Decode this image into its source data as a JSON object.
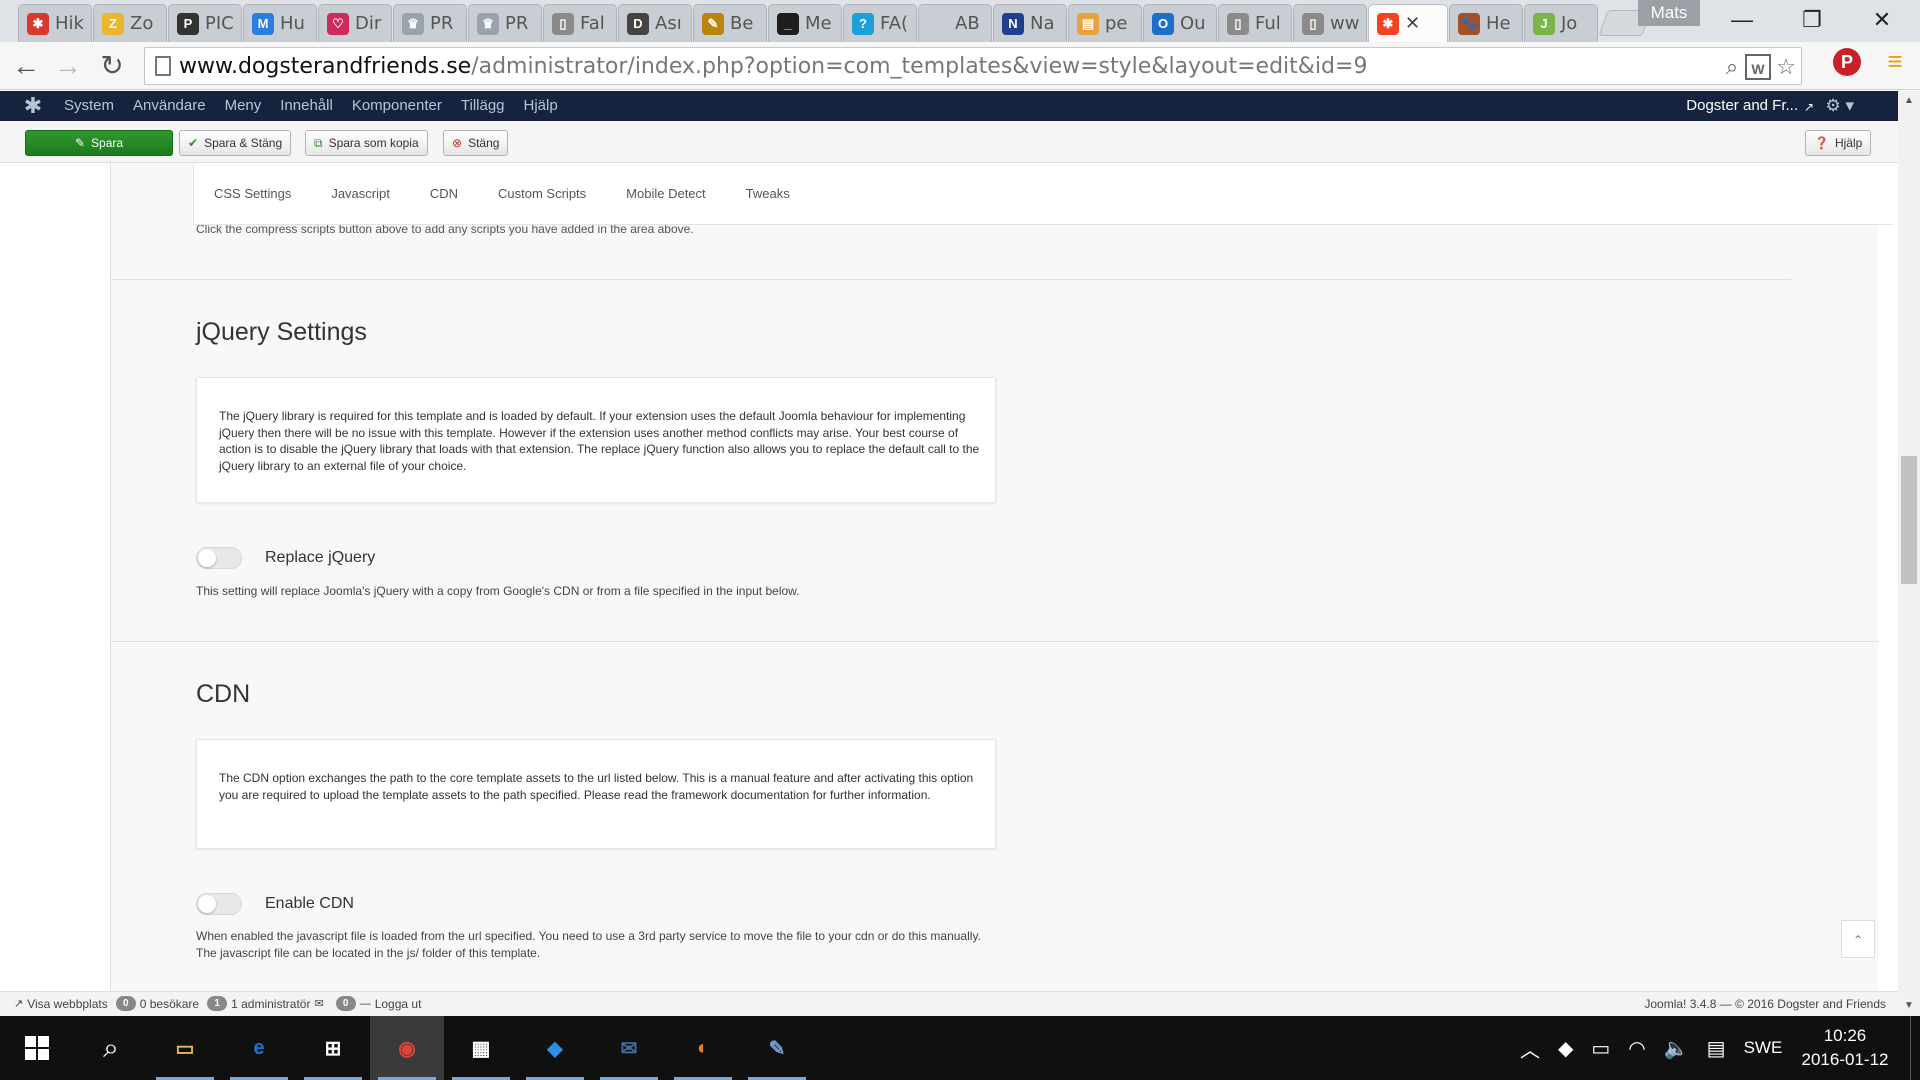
{
  "browser": {
    "tabs": [
      {
        "title": "Hik",
        "icon": "red-star-icon",
        "color": "#d9382e",
        "glyph": "✱"
      },
      {
        "title": "Zo",
        "icon": "zotero-icon",
        "color": "#e8b62f",
        "glyph": "Z"
      },
      {
        "title": "PIC",
        "icon": "pinterest-icon",
        "color": "#333333",
        "glyph": "P"
      },
      {
        "title": "Hu",
        "icon": "wordmark-m-icon",
        "color": "#2a7de1",
        "glyph": "M"
      },
      {
        "title": "Dir",
        "icon": "heart-icon",
        "color": "#d02a5a",
        "glyph": "♡"
      },
      {
        "title": "PR",
        "icon": "crown-icon",
        "color": "#9aa3ad",
        "glyph": "♛"
      },
      {
        "title": "PR",
        "icon": "crown-icon",
        "color": "#9aa3ad",
        "glyph": "♛"
      },
      {
        "title": "Fal",
        "icon": "page-icon",
        "color": "#8a8a8a",
        "glyph": "▯"
      },
      {
        "title": "Ası",
        "icon": "dm-icon",
        "color": "#444444",
        "glyph": "D"
      },
      {
        "title": "Be",
        "icon": "paint-icon",
        "color": "#b8860b",
        "glyph": "✎"
      },
      {
        "title": "Me",
        "icon": "terminal-icon",
        "color": "#1e1e1e",
        "glyph": "_"
      },
      {
        "title": "FA(",
        "icon": "faq-icon",
        "color": "#1e9fd8",
        "glyph": "?"
      },
      {
        "title": "AB",
        "icon": "blank-icon",
        "color": "#c9ced4",
        "glyph": ""
      },
      {
        "title": "Na",
        "icon": "notepad-icon",
        "color": "#1f3f8f",
        "glyph": "N"
      },
      {
        "title": "pe",
        "icon": "chart-icon",
        "color": "#e8a23b",
        "glyph": "▤"
      },
      {
        "title": "Ou",
        "icon": "outlook-icon",
        "color": "#1c6fc7",
        "glyph": "O"
      },
      {
        "title": "Ful",
        "icon": "page-icon",
        "color": "#8a8a8a",
        "glyph": "▯"
      },
      {
        "title": "ww",
        "icon": "page-icon",
        "color": "#8a8a8a",
        "glyph": "▯"
      },
      {
        "title": "",
        "icon": "joomla-icon",
        "color": "#f44321",
        "glyph": "✱",
        "active": true
      },
      {
        "title": "He",
        "icon": "dog-icon",
        "color": "#a0522d",
        "glyph": "🐾"
      },
      {
        "title": "Jo",
        "icon": "joomla-green-icon",
        "color": "#7ab648",
        "glyph": "J"
      }
    ],
    "close_glyph": "✕",
    "profile_name": "Mats",
    "url_host": "www.dogsterandfriends.se",
    "url_path": "/administrator/index.php?option=com_templates&view=style&layout=edit&id=9"
  },
  "admin": {
    "menu": [
      "System",
      "Användare",
      "Meny",
      "Innehåll",
      "Komponenter",
      "Tillägg",
      "Hjälp"
    ],
    "site_name": "Dogster and Fr...",
    "buttons": {
      "save": "Spara",
      "save_close": "Spara & Stäng",
      "save_copy": "Spara som kopia",
      "close": "Stäng",
      "help": "Hjälp"
    }
  },
  "template": {
    "tabs": [
      "CSS Settings",
      "Javascript",
      "CDN",
      "Custom Scripts",
      "Mobile Detect",
      "Tweaks"
    ],
    "compress_note": "Click the compress scripts button above to add any scripts you have added in the area above.",
    "jquery": {
      "title": "jQuery Settings",
      "info": "The jQuery library is required for this template and is loaded by default. If your extension uses the default Joomla behaviour for implementing jQuery then there will be no issue with this template. However if the extension uses another method conflicts may arise. Your best course of action is to disable the jQuery library that loads with that extension. The replace jQuery function also allows you to replace the default call to the jQuery library to an external file of your choice.",
      "toggle_label": "Replace jQuery",
      "toggle_on": false,
      "help": "This setting will replace Joomla's jQuery with a copy from Google's CDN or from a file specified in the input below."
    },
    "cdn": {
      "title": "CDN",
      "info": "The CDN option exchanges the path to the core template assets to the url listed below. This is a manual feature and after activating this option you are required to upload the template assets to the path specified. Please read the framework documentation for further information.",
      "toggle_label": "Enable CDN",
      "toggle_on": false,
      "help": "When enabled the javascript file is loaded from the url specified. You need to use a 3rd party service to move the file to your cdn or do this manually. The javascript file can be located in the js/ folder of this template."
    }
  },
  "status": {
    "view_site": "Visa webbplats",
    "visitors_count": "0",
    "visitors_label": "0 besökare",
    "admins_count": "1",
    "admins_label": "1 administratör",
    "messages_count": "0",
    "logout": "Logga ut",
    "version": "Joomla! 3.4.8",
    "copyright": "— © 2016 Dogster and Friends"
  },
  "taskbar": {
    "apps": [
      {
        "name": "file-explorer-icon",
        "color": "#e8b84a",
        "glyph": "▭"
      },
      {
        "name": "edge-icon",
        "color": "#1f73c9",
        "glyph": "e"
      },
      {
        "name": "store-icon",
        "color": "#ffffff",
        "glyph": "⊞"
      },
      {
        "name": "chrome-icon",
        "color": "#db4437",
        "glyph": "◉",
        "active": true
      },
      {
        "name": "calculator-icon",
        "color": "#ffffff",
        "glyph": "▦"
      },
      {
        "name": "dropbox-icon",
        "color": "#2b8fe3",
        "glyph": "◆"
      },
      {
        "name": "thunderbird-icon",
        "color": "#3f6ea8",
        "glyph": "✉"
      },
      {
        "name": "avidemux-icon",
        "color": "#e67e22",
        "glyph": "◐"
      },
      {
        "name": "paint-icon",
        "color": "#6f9fd8",
        "glyph": "✎"
      }
    ],
    "lang": "SWE",
    "time": "10:26",
    "date": "2016-01-12"
  },
  "colors": {
    "save_green": "#2a8f2a",
    "admin_bar": "#15233f"
  }
}
